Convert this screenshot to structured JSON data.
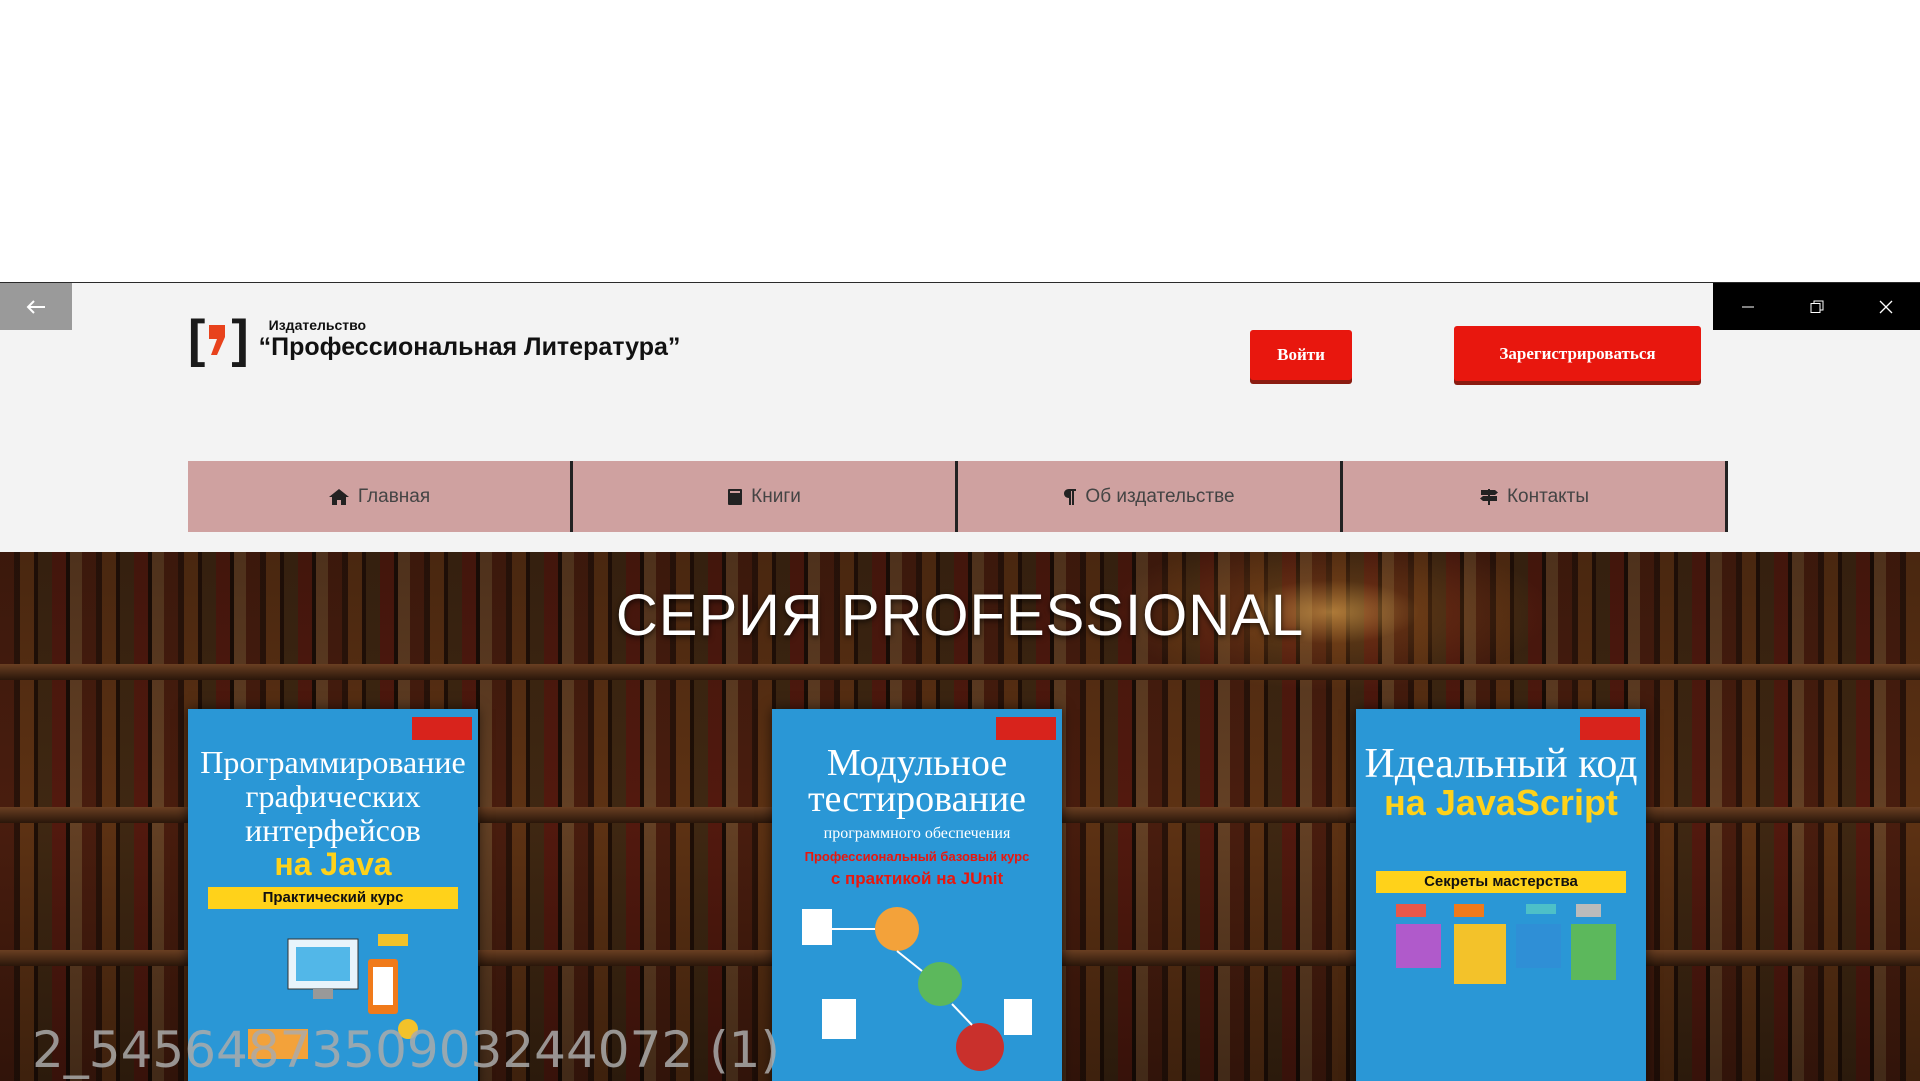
{
  "header": {
    "logo_small": "Издательство",
    "logo_big": "“Профессиональная Литература”",
    "login_label": "Войти",
    "register_label": "Зарегистрироваться"
  },
  "nav": [
    {
      "label": "Главная",
      "icon": "home-icon"
    },
    {
      "label": "Книги",
      "icon": "book-icon"
    },
    {
      "label": "Об издательстве",
      "icon": "paragraph-icon"
    },
    {
      "label": "Контакты",
      "icon": "signpost-icon"
    }
  ],
  "hero": {
    "title": "СЕРИЯ PROFESSIONAL"
  },
  "books": [
    {
      "title_main": "Программирование графических интерфейсов",
      "title_accent": "на Java",
      "band": "Практический курс"
    },
    {
      "title_main": "Модульное тестирование",
      "subtitle": "программного обеспечения",
      "red_sub": "Профессиональный базовый курс",
      "red_sub2": "с практикой на JUnit"
    },
    {
      "title_main": "Идеальный код",
      "title_accent": "на JavaScript",
      "band": "Секреты мастерства"
    }
  ],
  "watermark": "2_5456487350903244072 (1)",
  "colors": {
    "accent": "#e8170e",
    "nav_bg": "#cfa1a0",
    "book_blue": "#2a97d6"
  }
}
